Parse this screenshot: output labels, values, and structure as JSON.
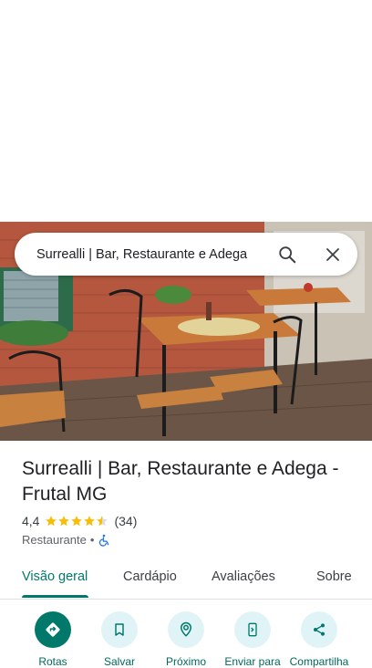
{
  "search": {
    "query": "Surrealli | Bar, Restaurante e Adega"
  },
  "place": {
    "title": "Surrealli | Bar, Restaurante e Adega - Frutal MG",
    "rating": "4,4",
    "rating_value": 4.4,
    "review_count": "(34)",
    "category": "Restaurante",
    "separator": "•",
    "accessibility_icon": "wheelchair-icon"
  },
  "tabs": [
    {
      "label": "Visão geral",
      "active": true
    },
    {
      "label": "Cardápio",
      "active": false
    },
    {
      "label": "Avaliações",
      "active": false
    },
    {
      "label": "Sobre",
      "active": false
    }
  ],
  "actions": [
    {
      "label": "Rotas",
      "icon": "directions-icon"
    },
    {
      "label": "Salvar",
      "icon": "bookmark-icon"
    },
    {
      "label": "Próximo",
      "icon": "nearby-icon"
    },
    {
      "label": "Enviar para",
      "icon": "send-to-phone-icon"
    },
    {
      "label": "Compartilha",
      "icon": "share-icon"
    }
  ],
  "colors": {
    "accent": "#00796b",
    "star": "#fbbc04",
    "action_bg": "#e0f4f8"
  }
}
